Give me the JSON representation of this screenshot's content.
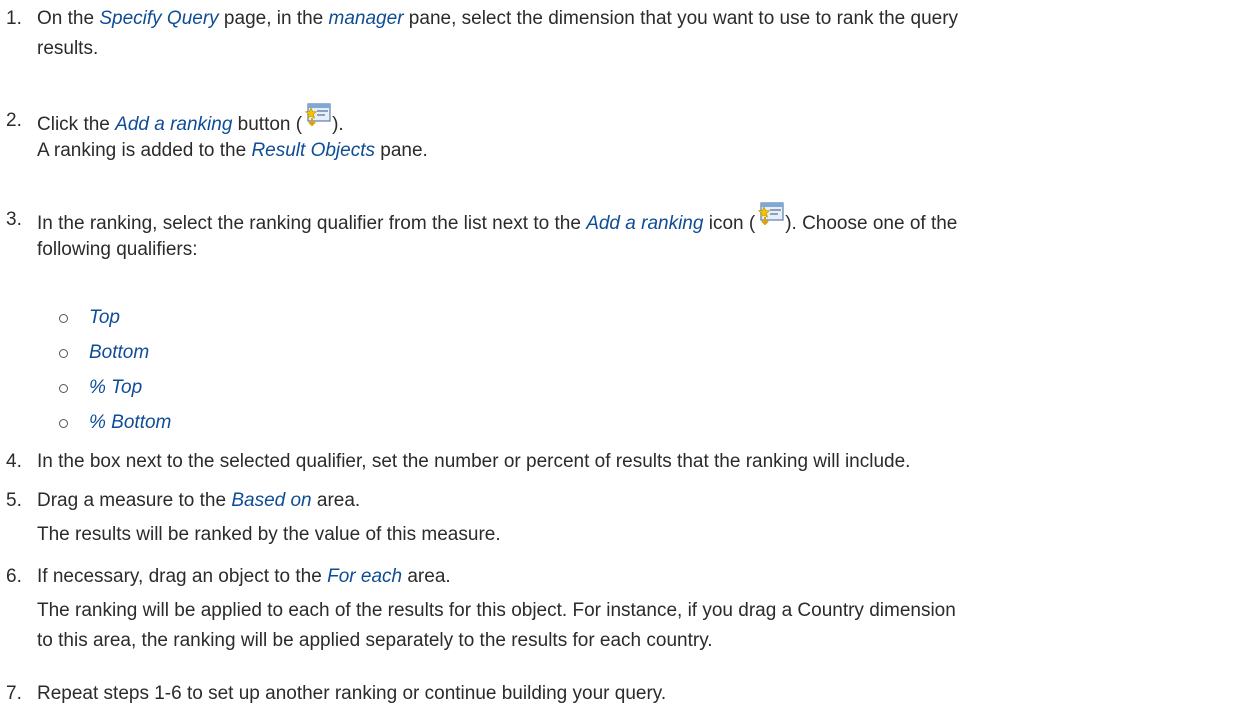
{
  "steps": [
    {
      "number": "1.",
      "lines": [
        {
          "parts": [
            {
              "t": "On the "
            },
            {
              "t": "Specify Query",
              "gui": true
            },
            {
              "t": " page, in the "
            },
            {
              "t": "manager",
              "gui": true
            },
            {
              "t": " pane, select the dimension that you want to use to rank the query"
            }
          ]
        },
        {
          "parts": [
            {
              "t": "results."
            }
          ]
        }
      ]
    },
    {
      "number": "2.",
      "lines": [
        {
          "parts": [
            {
              "t": "Click the "
            },
            {
              "t": "Add a ranking",
              "gui": true
            },
            {
              "t": " button ("
            },
            {
              "icon": "add-ranking-icon"
            },
            {
              "t": ")."
            }
          ]
        },
        {
          "parts": [
            {
              "t": "A ranking is added to the "
            },
            {
              "t": "Result Objects",
              "gui": true
            },
            {
              "t": " pane."
            }
          ]
        }
      ]
    },
    {
      "number": "3.",
      "lines": [
        {
          "parts": [
            {
              "t": "In the ranking, select the ranking qualifier from the list next to the "
            },
            {
              "t": "Add a ranking",
              "gui": true
            },
            {
              "t": " icon ("
            },
            {
              "icon": "add-ranking-icon"
            },
            {
              "t": "). Choose one of the"
            }
          ]
        },
        {
          "parts": [
            {
              "t": "following qualifiers:"
            }
          ]
        }
      ]
    },
    {
      "number": "4.",
      "lines": [
        {
          "parts": [
            {
              "t": "In the box next to the selected qualifier, set the number or percent of results that the ranking will include."
            }
          ]
        }
      ]
    },
    {
      "number": "5.",
      "lines": [
        {
          "parts": [
            {
              "t": "Drag a measure to the "
            },
            {
              "t": "Based on",
              "gui": true
            },
            {
              "t": " area."
            }
          ]
        },
        {
          "parts": [
            {
              "t": "The results will be ranked by the value of this measure."
            }
          ]
        }
      ]
    },
    {
      "number": "6.",
      "lines": [
        {
          "parts": [
            {
              "t": "If necessary, drag an object to the "
            },
            {
              "t": "For each",
              "gui": true
            },
            {
              "t": " area."
            }
          ]
        },
        {
          "parts": [
            {
              "t": "The ranking will be applied to each of the results for this object. For instance, if you drag a Country dimension"
            }
          ]
        },
        {
          "parts": [
            {
              "t": "to this area, the ranking will be applied separately to the results for each country."
            }
          ]
        }
      ]
    },
    {
      "number": "7.",
      "lines": [
        {
          "parts": [
            {
              "t": "Repeat steps 1-6 to set up another ranking or continue building your query."
            }
          ]
        }
      ]
    }
  ],
  "qualifiers": [
    "Top",
    "Bottom",
    "% Top",
    "% Bottom"
  ],
  "colors": {
    "text": "#2b2b2b",
    "gui_term": "#0f4c96"
  }
}
